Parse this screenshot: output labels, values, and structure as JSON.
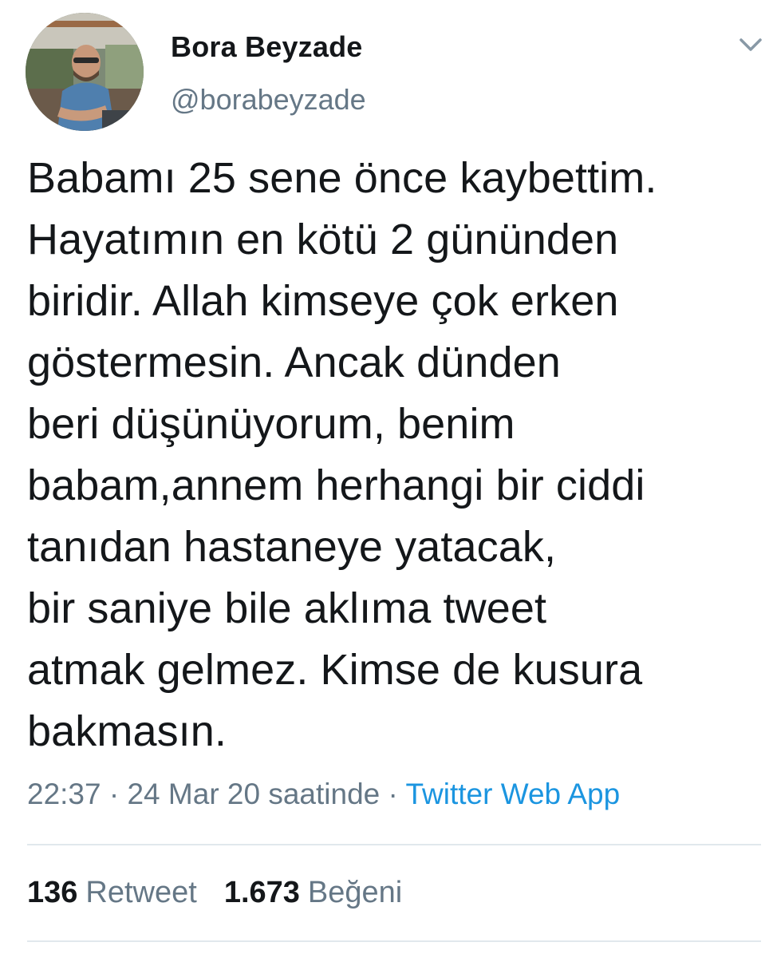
{
  "author": {
    "display_name": "Bora Beyzade",
    "handle": "@borabeyzade",
    "avatar_icon": "profile-photo"
  },
  "menu_icon": "chevron-down-icon",
  "tweet": {
    "text": "Babamı 25 sene önce kaybettim.\nHayatımın en kötü 2 gününden\nbiridir. Allah kimseye çok erken\ngöstermesin. Ancak dünden\nberi düşünüyorum, benim\nbabam,annem herhangi bir ciddi\ntanıdan hastaneye yatacak,\nbir saniye bile aklıma tweet\natmak gelmez. Kimse de kusura\nbakmasın."
  },
  "meta": {
    "time": "22:37",
    "separator1": " · ",
    "date": "24 Mar 20 saatinde",
    "separator2": " · ",
    "source": "Twitter Web App"
  },
  "stats": {
    "retweets_count": "136",
    "retweets_label": "Retweet",
    "likes_count": "1.673",
    "likes_label": "Beğeni"
  },
  "colors": {
    "text": "#14171a",
    "secondary": "#657786",
    "link": "#1b95e0",
    "divider": "#e1e8ed"
  }
}
